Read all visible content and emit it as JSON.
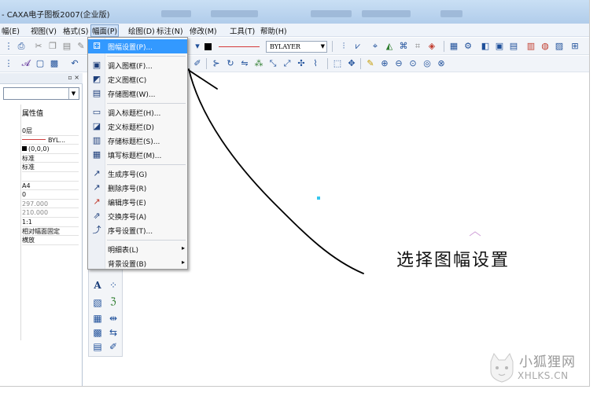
{
  "window": {
    "title": "- CAXA电子图板2007(企业版)"
  },
  "menubar": {
    "items": [
      {
        "label": "幅(E)"
      },
      {
        "label": "视图(V)"
      },
      {
        "label": "格式(S)"
      },
      {
        "label": "幅面(P)"
      },
      {
        "label": "绘图(D)"
      },
      {
        "label": "标注(N)"
      },
      {
        "label": "修改(M)"
      },
      {
        "label": "工具(T)"
      },
      {
        "label": "帮助(H)"
      }
    ],
    "active_index": 3
  },
  "toolbar": {
    "layer_combo": "BYLAYER"
  },
  "property_panel": {
    "header": "属性值",
    "rows": [
      {
        "value": "0层"
      },
      {
        "value": "BYL..."
      },
      {
        "value": "(0,0,0)"
      },
      {
        "value": "标准"
      },
      {
        "value": "标准"
      },
      {
        "value": ""
      },
      {
        "value": "A4"
      },
      {
        "value": "0"
      },
      {
        "value": "297.000"
      },
      {
        "value": "210.000"
      },
      {
        "value": "1:1"
      },
      {
        "value": "相对幅面固定"
      },
      {
        "value": "横放"
      }
    ]
  },
  "frame_menu": {
    "items": [
      {
        "label": "图幅设置(P)...",
        "icon": "sheet-setup-icon",
        "highlighted": true
      },
      {
        "label": "调入图框(F)...",
        "icon": "load-frame-icon"
      },
      {
        "label": "定义图框(C)",
        "icon": "define-frame-icon"
      },
      {
        "label": "存储图框(W)...",
        "icon": "save-frame-icon"
      },
      {
        "label": "调入标题栏(H)...",
        "icon": "load-titleblock-icon"
      },
      {
        "label": "定义标题栏(D)",
        "icon": "define-titleblock-icon"
      },
      {
        "label": "存储标题栏(S)...",
        "icon": "save-titleblock-icon"
      },
      {
        "label": "填写标题栏(M)...",
        "icon": "fill-titleblock-icon"
      },
      {
        "label": "生成序号(G)",
        "icon": "gen-number-icon"
      },
      {
        "label": "删除序号(R)",
        "icon": "delete-number-icon"
      },
      {
        "label": "编辑序号(E)",
        "icon": "edit-number-icon"
      },
      {
        "label": "交换序号(A)",
        "icon": "swap-number-icon"
      },
      {
        "label": "序号设置(T)...",
        "icon": "number-settings-icon"
      },
      {
        "label": "明细表(L)",
        "icon": "",
        "submenu": true
      },
      {
        "label": "背景设置(B)",
        "icon": "",
        "submenu": true
      }
    ]
  },
  "annotation": {
    "text": "选择图幅设置"
  },
  "watermark": {
    "cn": "小狐狸网",
    "en": "XHLKS.CN"
  },
  "colors": {
    "highlight": "#3399ff",
    "accent_blue": "#36c6ee",
    "menu_bg": "#f7f7f7"
  }
}
